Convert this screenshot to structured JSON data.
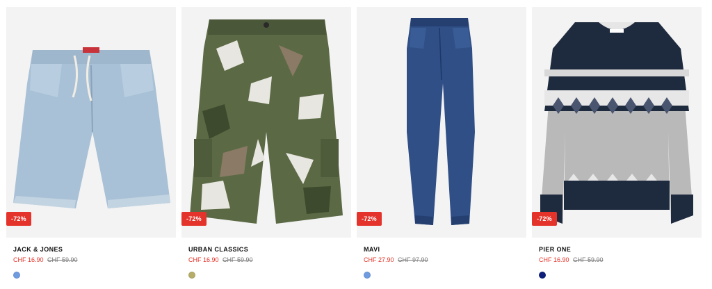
{
  "products": [
    {
      "brand": "JACK & JONES",
      "price": "CHF 16.90",
      "old_price": "CHF 59.90",
      "discount": "-72%",
      "swatch_color": "#6f9be0",
      "item": "denim-shorts"
    },
    {
      "brand": "URBAN CLASSICS",
      "price": "CHF 16.90",
      "old_price": "CHF 59.90",
      "discount": "-72%",
      "swatch_color": "#b6ad68",
      "item": "camo-cargo-shorts"
    },
    {
      "brand": "MAVI",
      "price": "CHF 27.90",
      "old_price": "CHF 97.90",
      "discount": "-72%",
      "swatch_color": "#6f9be0",
      "item": "jeans"
    },
    {
      "brand": "PIER ONE",
      "price": "CHF 16.90",
      "old_price": "CHF 59.90",
      "discount": "-72%",
      "swatch_color": "#0d1f7a",
      "item": "knit-sweater"
    }
  ]
}
